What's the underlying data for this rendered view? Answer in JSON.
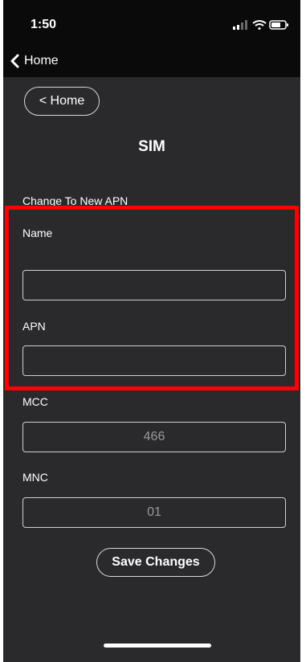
{
  "status_bar": {
    "time": "1:50",
    "icons": [
      "signal-icon",
      "wifi-icon",
      "battery-icon"
    ]
  },
  "nav": {
    "back_label": "Home",
    "back_icon": "chevron-left-icon"
  },
  "page": {
    "home_button_label": "< Home",
    "title": "SIM"
  },
  "form": {
    "section_title": "Change To New APN",
    "name_label": "Name",
    "name_value": "",
    "apn_label": "APN",
    "apn_value": "",
    "mcc_label": "MCC",
    "mcc_value": "466",
    "mnc_label": "MNC",
    "mnc_value": "01",
    "save_label": "Save Changes"
  },
  "colors": {
    "highlight": "#ff0000",
    "background": "#2a2a2d",
    "bar": "#0a0a0a"
  }
}
